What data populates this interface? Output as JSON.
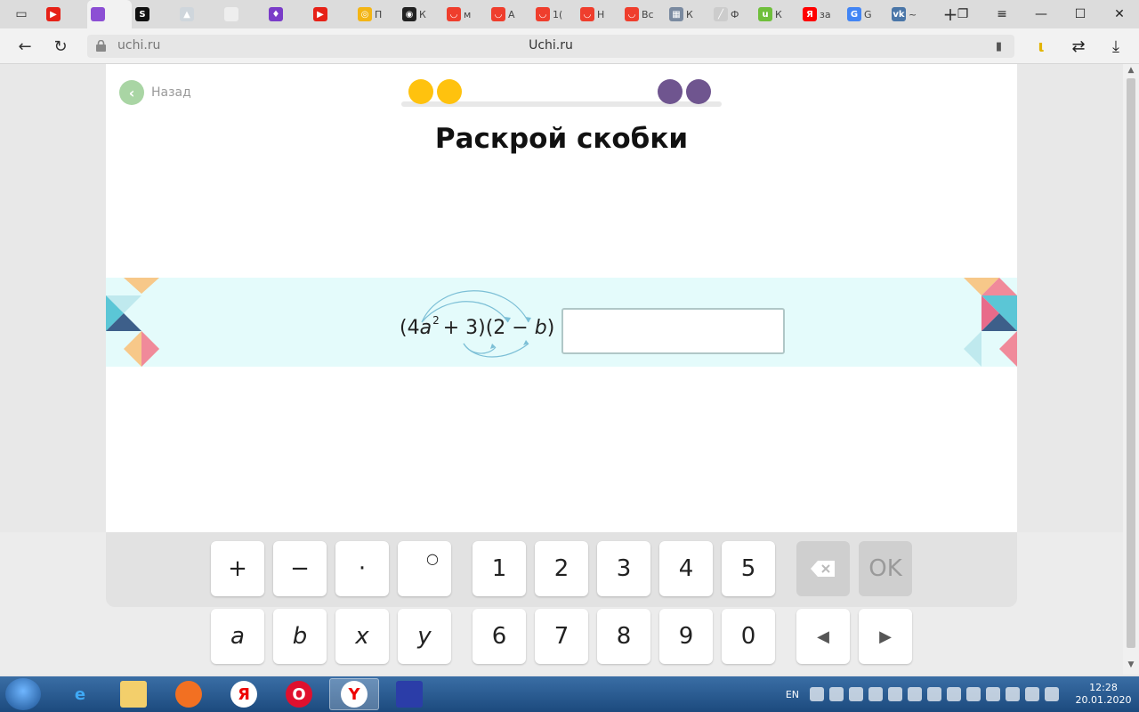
{
  "browser": {
    "tabs": [
      {
        "icon": "youtube-icon",
        "text": "",
        "color": "#e62117",
        "glyph": "▶"
      },
      {
        "icon": "app-icon",
        "text": "",
        "color": "#8c4fd4",
        "glyph": "",
        "active": true
      },
      {
        "icon": "s-icon",
        "text": "",
        "color": "#111111",
        "glyph": "S"
      },
      {
        "icon": "cloud-icon",
        "text": "",
        "color": "#cfd6dc",
        "glyph": "▲"
      },
      {
        "icon": "page-icon",
        "text": "",
        "color": "#eeeeee",
        "glyph": ""
      },
      {
        "icon": "drop-icon",
        "text": "",
        "color": "#7a3cc8",
        "glyph": "♦"
      },
      {
        "icon": "youtube-audio-icon",
        "text": "",
        "color": "#e62117",
        "glyph": "▶"
      },
      {
        "icon": "camera-icon",
        "text": "П",
        "color": "#f3b516",
        "glyph": "◎"
      },
      {
        "icon": "aperture-icon",
        "text": "К",
        "color": "#222222",
        "glyph": "◉"
      },
      {
        "icon": "uchi-icon",
        "text": "м",
        "color": "#ef3e2d",
        "glyph": "◡"
      },
      {
        "icon": "uchi-icon",
        "text": "А",
        "color": "#ef3e2d",
        "glyph": "◡"
      },
      {
        "icon": "uchi-icon",
        "text": "1(",
        "color": "#ef3e2d",
        "glyph": "◡"
      },
      {
        "icon": "uchi-icon",
        "text": "Н",
        "color": "#ef3e2d",
        "glyph": "◡"
      },
      {
        "icon": "uchi-icon",
        "text": "Вс",
        "color": "#ef3e2d",
        "glyph": "◡"
      },
      {
        "icon": "grid-icon",
        "text": "К",
        "color": "#7a8aa0",
        "glyph": "▦"
      },
      {
        "icon": "pen-icon",
        "text": "Ф",
        "color": "#cccccc",
        "glyph": "╱"
      },
      {
        "icon": "u-icon",
        "text": "К",
        "color": "#6fbf3b",
        "glyph": "u"
      },
      {
        "icon": "yandex-icon",
        "text": "за",
        "color": "#ff0000",
        "glyph": "Я"
      },
      {
        "icon": "translate-icon",
        "text": "G",
        "color": "#4285f4",
        "glyph": "G"
      },
      {
        "icon": "vk-icon",
        "text": "~",
        "color": "#4a76a8",
        "glyph": "vk"
      }
    ],
    "url_host": "uchi.ru",
    "page_title": "Uchi.ru"
  },
  "page": {
    "back_label": "Назад",
    "title": "Раскрой скобки",
    "progress": {
      "done": 2,
      "total": 4
    },
    "expression": {
      "open1": "(4",
      "var_a": "a",
      "exp": "2",
      "plus3": "+ 3)(2 −",
      "var_b": "b",
      "close": ") ="
    },
    "answer_placeholder": ""
  },
  "keyboard": {
    "row1": [
      "+",
      "−",
      "·",
      "○",
      "1",
      "2",
      "3",
      "4",
      "5"
    ],
    "row2": [
      "a",
      "b",
      "x",
      "y",
      "6",
      "7",
      "8",
      "9",
      "0"
    ],
    "ok_label": "OK",
    "backspace_icon": "backspace-icon",
    "left_icon": "left-arrow-icon",
    "right_icon": "right-arrow-icon"
  },
  "taskbar": {
    "lang": "EN",
    "time": "12:28",
    "date": "20.01.2020"
  },
  "colors": {
    "progress_done": "#ffc20e",
    "progress_todo": "#6f558f",
    "band": "#e4fbfb",
    "back": "#a9d5a4"
  }
}
